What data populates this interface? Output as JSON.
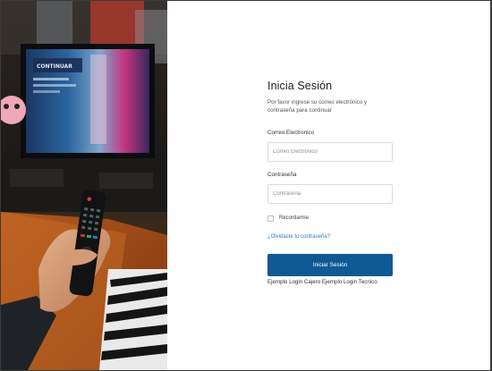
{
  "login": {
    "title": "Inicia Sesión",
    "subtitle": "Por favor ingrese su correo electrónico y contraseña para continuar",
    "email_label": "Correo Electronico",
    "email_placeholder": "Correo Electronico",
    "email_value": "",
    "password_label": "Contraseña",
    "password_placeholder": "Contraseña",
    "password_value": "",
    "remember_label": "Recordarme",
    "forgot_link": "¿Olvidaste tu contraseña?",
    "submit_label": "Iniciar Sesión",
    "example_cashier": "Ejemplo Login Cajero",
    "example_tech": "Ejemplo Login Tecnico"
  },
  "hero": {
    "description_icon": "tv-remote-photo",
    "tv_screen_text": "CONTINUAR"
  },
  "colors": {
    "primary_button": "#0f5a96",
    "link": "#2e78c2",
    "input_border": "#d9dde2"
  }
}
